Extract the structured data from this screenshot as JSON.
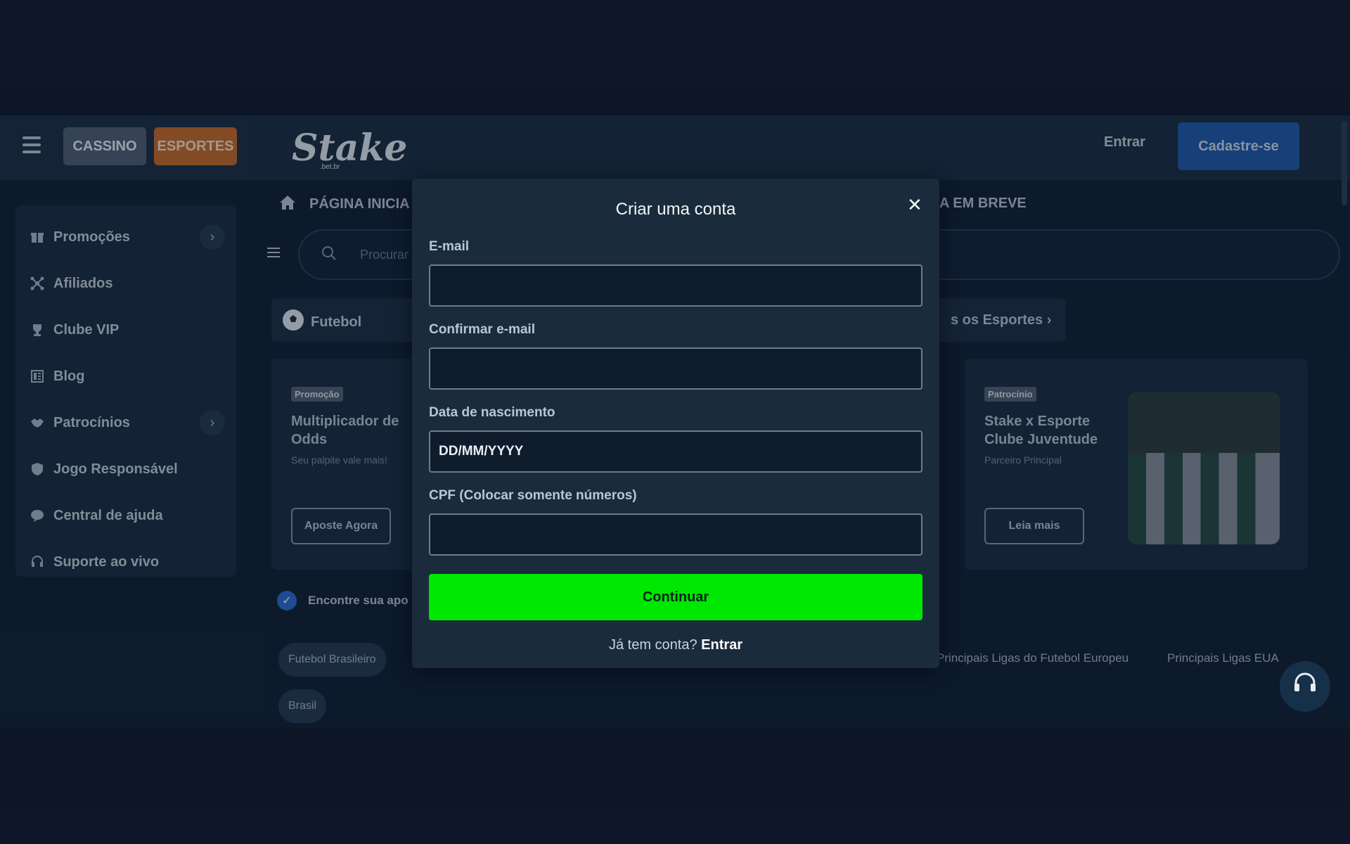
{
  "header": {
    "cassino_label": "CASSINO",
    "esportes_label": "ESPORTES",
    "logo_text": "Stake",
    "logo_sub": ".bet.br",
    "entrar_label": "Entrar",
    "cadastre_label": "Cadastre-se"
  },
  "sidebar": {
    "items": [
      {
        "label": "Promoções",
        "icon": "gift-icon",
        "has_chevron": true
      },
      {
        "label": "Afiliados",
        "icon": "affiliates-icon",
        "has_chevron": false
      },
      {
        "label": "Clube VIP",
        "icon": "trophy-icon",
        "has_chevron": false
      },
      {
        "label": "Blog",
        "icon": "blog-icon",
        "has_chevron": false
      },
      {
        "label": "Patrocínios",
        "icon": "handshake-icon",
        "has_chevron": true
      },
      {
        "label": "Jogo Responsável",
        "icon": "shield-icon",
        "has_chevron": false
      },
      {
        "label": "Central de ajuda",
        "icon": "chat-icon",
        "has_chevron": false
      },
      {
        "label": "Suporte ao vivo",
        "icon": "headset-icon",
        "has_chevron": false
      }
    ]
  },
  "main": {
    "nav_home": "PÁGINA INICIA",
    "nav_breve": "A EM BREVE",
    "search_placeholder": "Procurar",
    "sport_futebol": "Futebol",
    "sport_todos": "s os Esportes ›",
    "card1": {
      "tag": "Promoção",
      "title": "Multiplicador de Odds",
      "sub": "Seu palpite vale mais!",
      "button": "Aposte Agora"
    },
    "card2": {
      "tag": "Patrocínio",
      "title": "Stake x Esporte Clube Juventude",
      "sub": "Parceiro Principal",
      "button": "Leia mais"
    },
    "encontre": "Encontre sua apo",
    "chips": [
      "Futebol Brasileiro",
      "Brasil"
    ],
    "league_links": [
      "Principais Ligas do Futebol Europeu",
      "Principais Ligas EUA"
    ]
  },
  "modal": {
    "title": "Criar uma conta",
    "email_label": "E-mail",
    "email_value": "",
    "confirm_label": "Confirmar e-mail",
    "confirm_value": "",
    "dob_label": "Data de nascimento",
    "dob_placeholder": "DD/MM/YYYY",
    "cpf_label": "CPF (Colocar somente números)",
    "cpf_value": "",
    "continue_label": "Continuar",
    "footer_text": "Já tem conta?",
    "footer_link": "Entrar"
  },
  "colors": {
    "accent_green": "#00e701",
    "brand_blue": "#1f5aa8",
    "modal_bg": "#1a2c3c"
  }
}
